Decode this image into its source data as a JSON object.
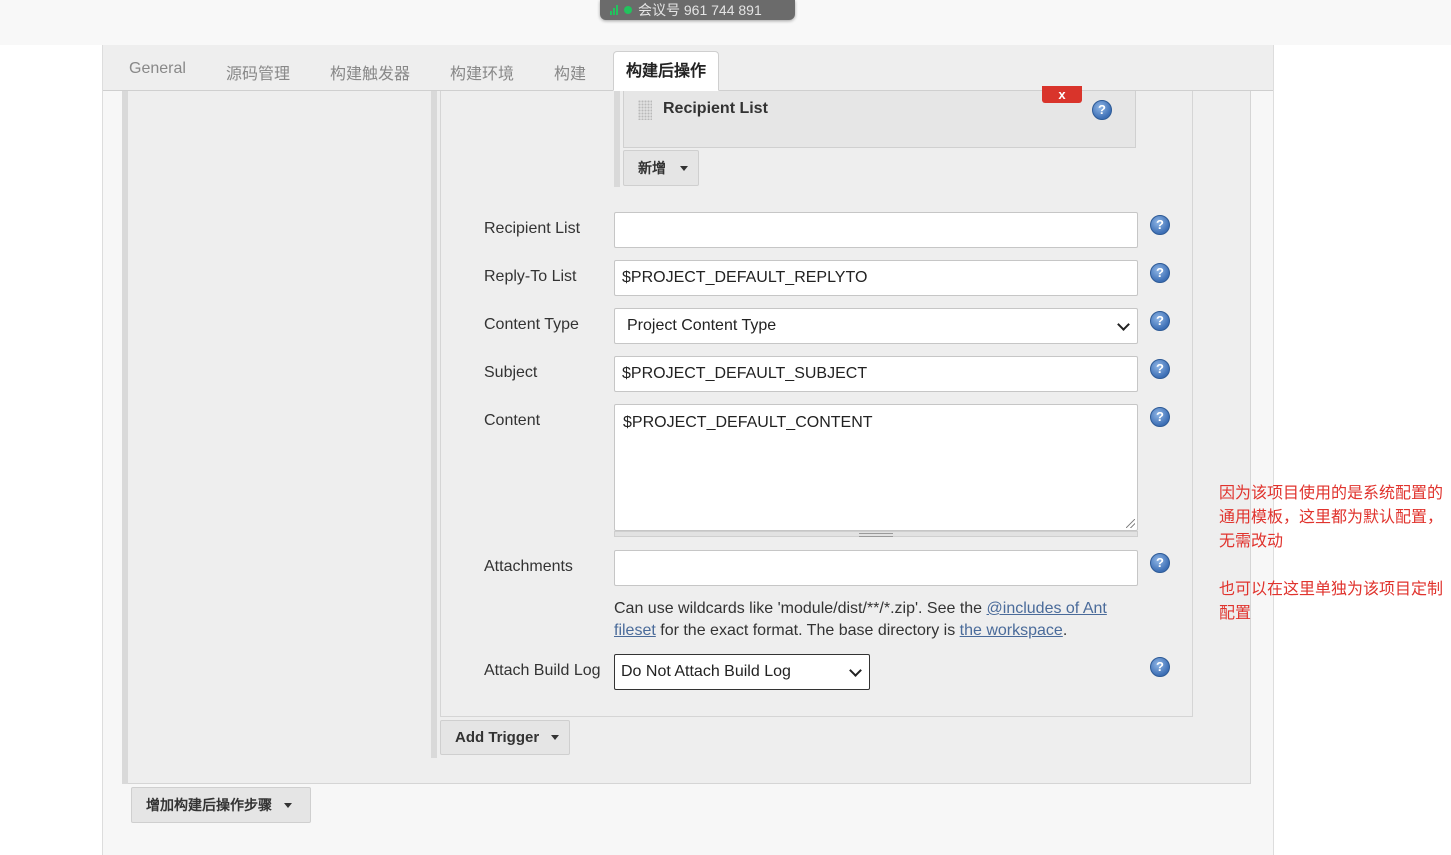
{
  "meeting": {
    "text": "会议号 961 744 891"
  },
  "tabs": [
    {
      "label": "General"
    },
    {
      "label": "源码管理"
    },
    {
      "label": "构建触发器"
    },
    {
      "label": "构建环境"
    },
    {
      "label": "构建"
    },
    {
      "label": "构建后操作",
      "active": true
    }
  ],
  "recipient_block": {
    "title": "Recipient List",
    "delete_label": "x",
    "add_label": "新增"
  },
  "form": {
    "recipient_list": {
      "label": "Recipient List",
      "value": ""
    },
    "reply_to": {
      "label": "Reply-To List",
      "value": "$PROJECT_DEFAULT_REPLYTO"
    },
    "content_type": {
      "label": "Content Type",
      "value": "Project Content Type"
    },
    "subject": {
      "label": "Subject",
      "value": "$PROJECT_DEFAULT_SUBJECT"
    },
    "content": {
      "label": "Content",
      "value": "$PROJECT_DEFAULT_CONTENT"
    },
    "attachments": {
      "label": "Attachments",
      "value": ""
    },
    "attachments_hint": {
      "prefix": "Can use wildcards like 'module/dist/**/*.zip'. See the ",
      "link1": "@includes of Ant fileset",
      "middle": " for the exact format. The base directory is ",
      "link2": "the workspace",
      "suffix": "."
    },
    "attach_build_log": {
      "label": "Attach Build Log",
      "value": "Do Not Attach Build Log"
    }
  },
  "buttons": {
    "add_trigger": "Add Trigger",
    "add_post_build_step": "增加构建后操作步骤"
  },
  "help_icon_text": "?",
  "annotations": {
    "note1": "因为该项目使用的是系统配置的通用模板，这里都为默认配置，无需改动",
    "note2": "也可以在这里单独为该项目定制配置"
  },
  "colors": {
    "annotation": "#e0332d",
    "delete_button": "#d9342b",
    "help_icon": "#3d6fb5",
    "signal": "#22c35e"
  }
}
